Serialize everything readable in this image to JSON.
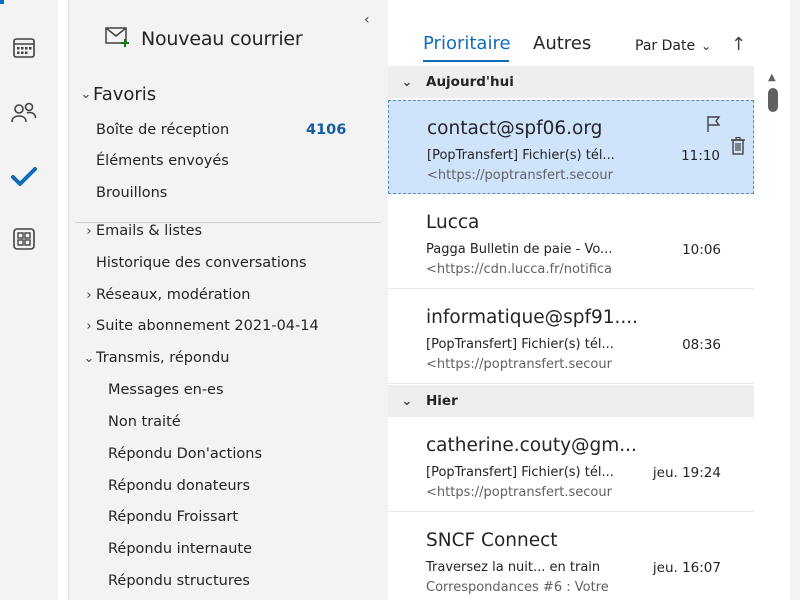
{
  "compose": {
    "label": "Nouveau courrier"
  },
  "folders": {
    "favoris": "Favoris",
    "inbox": "Boîte de réception",
    "inbox_count": "4106",
    "sent": "Éléments envoyés",
    "drafts": "Brouillons",
    "emails_listes": "Emails & listes",
    "historique": "Historique des conversations",
    "reseaux": "Réseaux, modération",
    "suite": "Suite abonnement 2021-04-14",
    "transmis": "Transmis, répondu",
    "sub": [
      "Messages en-es",
      "Non traité",
      "Répondu Don'actions",
      "Répondu donateurs",
      "Répondu Froissart",
      "Répondu internaute",
      "Répondu structures"
    ]
  },
  "tabs": {
    "focused": "Prioritaire",
    "other": "Autres"
  },
  "sort": {
    "label": "Par Date"
  },
  "groups": {
    "today": "Aujourd'hui",
    "yesterday": "Hier"
  },
  "messages": [
    {
      "sender": "contact@spf06.org",
      "subject": "[PopTransfert] Fichier(s) tél...",
      "preview": "<https://poptransfert.secour",
      "time": "11:10"
    },
    {
      "sender": "Lucca",
      "subject": "Pagga Bulletin de paie - Vo...",
      "preview": "<https://cdn.lucca.fr/notifica",
      "time": "10:06"
    },
    {
      "sender": "informatique@spf91....",
      "subject": "[PopTransfert] Fichier(s) tél...",
      "preview": "<https://poptransfert.secour",
      "time": "08:36"
    },
    {
      "sender": "catherine.couty@gm...",
      "subject": "[PopTransfert] Fichier(s) tél...",
      "preview": "<https://poptransfert.secour",
      "time": "jeu. 19:24"
    },
    {
      "sender": "SNCF Connect",
      "subject": "Traversez la nuit... en train",
      "preview": "Correspondances #6 : Votre",
      "time": "jeu. 16:07"
    }
  ],
  "icons": {
    "calendar": "calendar-icon",
    "people": "people-icon",
    "todo": "todo-check-icon",
    "apps": "apps-icon",
    "compose": "compose-icon",
    "flag": "flag-icon",
    "delete": "trash-icon"
  },
  "colors": {
    "accent": "#0f6cbd",
    "selected": "#cfe4fa",
    "badge": "#115ea3"
  }
}
